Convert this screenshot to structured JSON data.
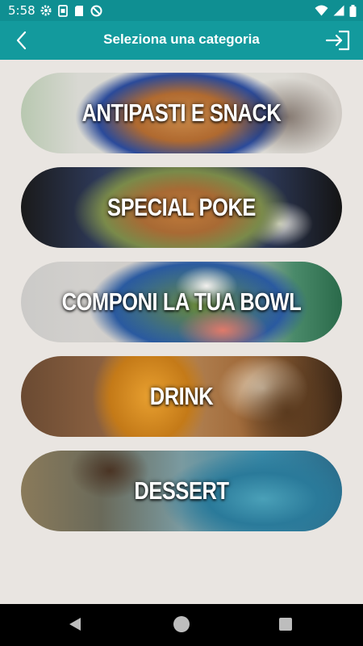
{
  "status_bar": {
    "time": "5:58",
    "icons_left": [
      "gear-icon",
      "sim-icon",
      "sd-card-icon",
      "at-sign-icon"
    ],
    "icons_right": [
      "wifi-icon",
      "cellular-signal-icon",
      "battery-icon"
    ]
  },
  "app_bar": {
    "title": "Seleziona una categoria",
    "back_icon": "chevron-left-icon",
    "action_icon": "login-icon",
    "color": "#139a9d"
  },
  "categories": [
    {
      "label": "ANTIPASTI E SNACK"
    },
    {
      "label": "SPECIAL POKE"
    },
    {
      "label": "COMPONI LA TUA BOWL"
    },
    {
      "label": "DRINK"
    },
    {
      "label": "DESSERT"
    }
  ],
  "nav_bar": {
    "icons": [
      "back-triangle-icon",
      "home-circle-icon",
      "recents-square-icon"
    ]
  }
}
